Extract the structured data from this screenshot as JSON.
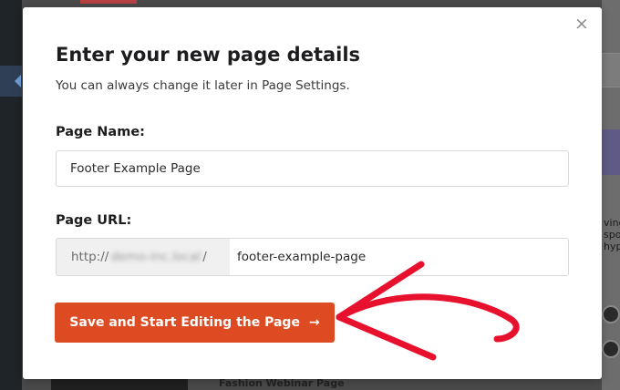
{
  "modal": {
    "title": "Enter your new page details",
    "subtitle": "You can always change it later in Page Settings.",
    "close_icon": "×",
    "page_name": {
      "label": "Page Name:",
      "value": "Footer Example Page"
    },
    "page_url": {
      "label": "Page URL:",
      "prefix_start": "http://",
      "prefix_blurred": "demo-inc.local",
      "prefix_end": "/",
      "slug": "footer-example-page"
    },
    "save_button": {
      "label": "Save and Start Editing the Page",
      "arrow": "→"
    }
  },
  "background": {
    "bottom_text": "Fashion Webinar Page",
    "right_text": "ving spond hyp"
  },
  "colors": {
    "accent": "#dd4b22",
    "annotation_arrow": "#e8112d"
  },
  "icons": [
    "close-icon",
    "arrow-right-icon",
    "left-arrow-icon"
  ]
}
